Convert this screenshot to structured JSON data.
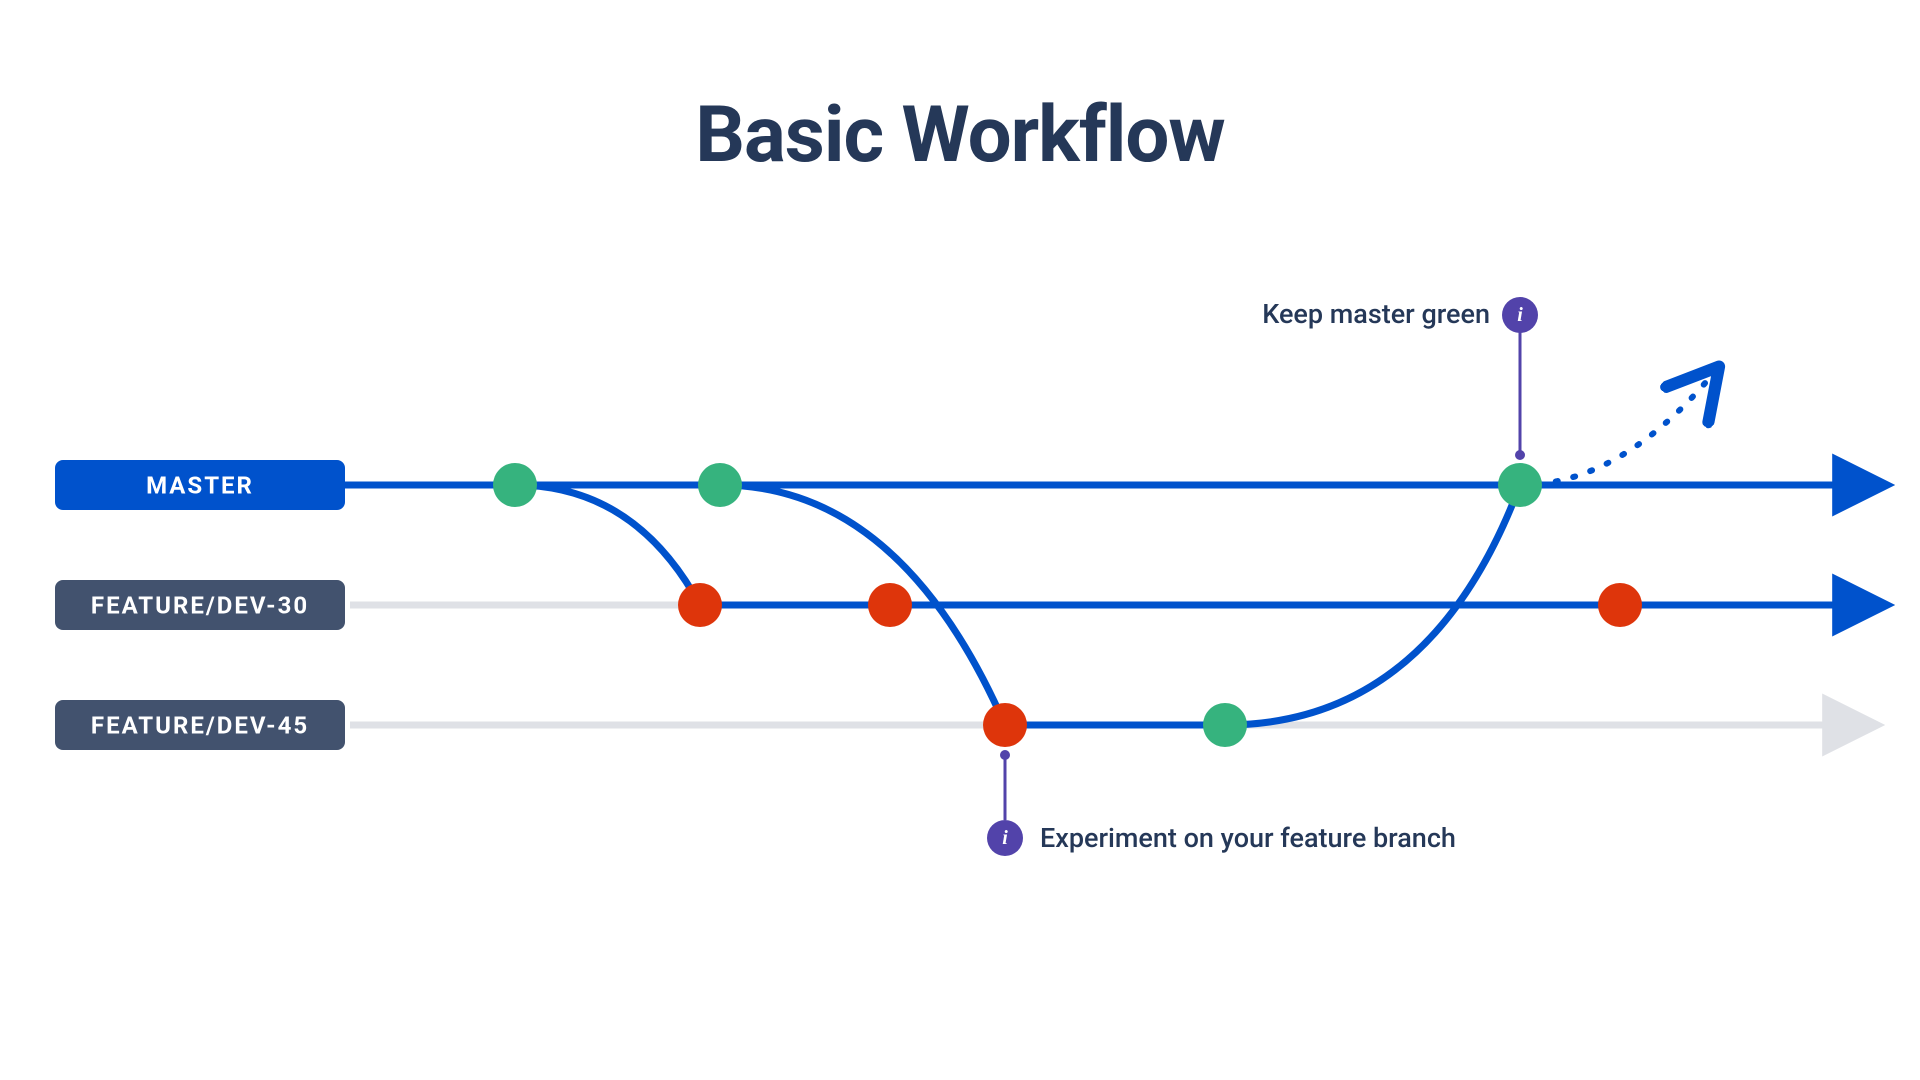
{
  "title": "Basic Workflow",
  "branches": {
    "master": "MASTER",
    "feature30": "FEATURE/DEV-30",
    "feature45": "FEATURE/DEV-45"
  },
  "notes": {
    "top": "Keep master green",
    "bottom": "Experiment on your feature branch"
  },
  "colors": {
    "blue": "#0052cc",
    "darknavy": "#42526e",
    "red": "#de350b",
    "green": "#00a86b",
    "purple": "#5243aa",
    "grey": "#dfe1e6",
    "textdark": "#253858"
  }
}
